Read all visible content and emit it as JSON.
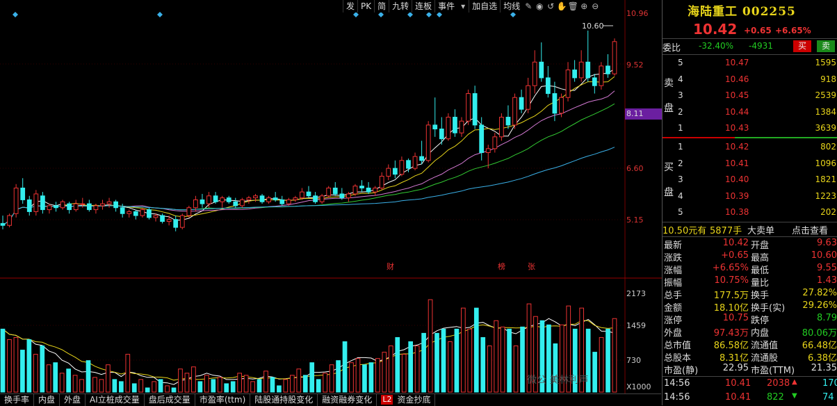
{
  "toolbar": {
    "items": [
      "发",
      "PK",
      "简",
      "九转",
      "连板",
      "事件"
    ],
    "more_items": [
      "加自选",
      "均线"
    ],
    "icons": [
      "dropdown-icon",
      "pen-icon",
      "eye-icon",
      "undo-icon",
      "hand-icon",
      "delete-icon",
      "zoom-in-icon",
      "zoom-out-icon"
    ]
  },
  "colors": {
    "up": "#e33",
    "down": "#3ee",
    "ma5": "#ffffff",
    "ma10": "#e8d51a",
    "ma20": "#d47ad4",
    "ma30": "#3c3",
    "ma60": "#3ab0e8"
  },
  "chart_data": {
    "type": "candlestick",
    "price_axis_ticks": [
      "10.96",
      "9.52",
      "8.11",
      "6.60",
      "5.15"
    ],
    "current_price_tag": "8.11",
    "high_marker": "10.60",
    "event_markers": [
      "财",
      "榜",
      "张"
    ],
    "volume_axis_ticks": [
      "2173",
      "1459",
      "730",
      "X1000"
    ],
    "ylim": [
      4.5,
      11.3
    ],
    "candles": [
      [
        5.8,
        6.0,
        5.65,
        5.75
      ],
      [
        5.75,
        6.05,
        5.7,
        6.0
      ],
      [
        6.05,
        6.8,
        5.95,
        6.7
      ],
      [
        6.7,
        6.95,
        6.3,
        6.4
      ],
      [
        6.4,
        6.5,
        6.0,
        6.1
      ],
      [
        6.1,
        6.65,
        6.0,
        6.55
      ],
      [
        6.5,
        6.6,
        6.05,
        6.15
      ],
      [
        6.15,
        6.3,
        6.05,
        6.25
      ],
      [
        6.25,
        6.35,
        6.1,
        6.2
      ],
      [
        6.2,
        6.4,
        6.15,
        6.35
      ],
      [
        6.3,
        6.35,
        6.05,
        6.15
      ],
      [
        6.15,
        6.4,
        6.1,
        6.3
      ],
      [
        6.3,
        6.45,
        6.2,
        6.3
      ],
      [
        6.3,
        6.4,
        6.1,
        6.15
      ],
      [
        6.15,
        6.3,
        6.05,
        6.25
      ],
      [
        6.25,
        6.4,
        6.15,
        6.3
      ],
      [
        6.3,
        6.45,
        6.2,
        6.35
      ],
      [
        6.35,
        6.4,
        6.1,
        6.2
      ],
      [
        6.2,
        6.3,
        5.95,
        6.05
      ],
      [
        6.05,
        6.15,
        5.95,
        6.1
      ],
      [
        6.1,
        6.15,
        5.9,
        6.0
      ],
      [
        6.0,
        6.2,
        5.95,
        6.15
      ],
      [
        6.15,
        6.2,
        5.9,
        5.95
      ],
      [
        5.95,
        6.05,
        5.85,
        6.0
      ],
      [
        6.0,
        6.05,
        5.8,
        5.85
      ],
      [
        5.85,
        6.0,
        5.75,
        5.9
      ],
      [
        5.9,
        6.0,
        5.6,
        5.7
      ],
      [
        5.7,
        6.05,
        5.65,
        6.0
      ],
      [
        6.0,
        6.25,
        5.95,
        6.2
      ],
      [
        6.2,
        6.5,
        6.1,
        6.4
      ],
      [
        6.4,
        6.55,
        6.2,
        6.3
      ],
      [
        6.3,
        6.6,
        6.2,
        6.5
      ],
      [
        6.5,
        6.6,
        6.3,
        6.35
      ],
      [
        6.35,
        6.5,
        6.2,
        6.45
      ],
      [
        6.45,
        6.5,
        6.3,
        6.35
      ],
      [
        6.35,
        6.45,
        6.2,
        6.25
      ],
      [
        6.25,
        6.45,
        6.2,
        6.4
      ],
      [
        6.4,
        6.5,
        6.3,
        6.45
      ],
      [
        6.45,
        6.55,
        6.35,
        6.5
      ],
      [
        6.5,
        6.55,
        6.3,
        6.35
      ],
      [
        6.35,
        6.5,
        6.3,
        6.45
      ],
      [
        6.45,
        6.6,
        6.35,
        6.4
      ],
      [
        6.4,
        6.5,
        6.25,
        6.3
      ],
      [
        6.3,
        6.45,
        6.25,
        6.4
      ],
      [
        6.4,
        6.5,
        6.35,
        6.45
      ],
      [
        6.45,
        6.7,
        6.4,
        6.6
      ],
      [
        6.6,
        6.75,
        6.45,
        6.5
      ],
      [
        6.5,
        6.6,
        6.3,
        6.35
      ],
      [
        6.35,
        6.55,
        6.3,
        6.5
      ],
      [
        6.5,
        6.75,
        6.45,
        6.7
      ],
      [
        6.7,
        6.85,
        6.5,
        6.55
      ],
      [
        6.55,
        6.7,
        6.4,
        6.45
      ],
      [
        6.45,
        6.6,
        6.35,
        6.55
      ],
      [
        6.55,
        6.8,
        6.5,
        6.75
      ],
      [
        6.75,
        6.9,
        6.6,
        6.7
      ],
      [
        6.7,
        6.85,
        6.55,
        6.6
      ],
      [
        6.6,
        6.75,
        6.5,
        6.7
      ],
      [
        6.7,
        7.1,
        6.65,
        7.0
      ],
      [
        7.0,
        7.3,
        6.9,
        7.2
      ],
      [
        7.2,
        7.4,
        6.95,
        7.05
      ],
      [
        7.05,
        7.5,
        7.0,
        7.4
      ],
      [
        7.4,
        7.45,
        7.1,
        7.2
      ],
      [
        7.2,
        7.6,
        7.15,
        7.5
      ],
      [
        7.5,
        7.9,
        7.3,
        7.4
      ],
      [
        7.4,
        8.4,
        7.35,
        8.3
      ],
      [
        8.3,
        9.0,
        8.0,
        8.2
      ],
      [
        8.2,
        8.5,
        7.8,
        7.95
      ],
      [
        7.95,
        8.6,
        7.9,
        8.5
      ],
      [
        8.5,
        8.7,
        8.0,
        8.1
      ],
      [
        8.1,
        8.5,
        8.0,
        8.4
      ],
      [
        8.4,
        9.2,
        8.3,
        9.1
      ],
      [
        9.1,
        9.3,
        8.2,
        8.3
      ],
      [
        8.3,
        8.5,
        7.4,
        7.6
      ],
      [
        7.6,
        7.8,
        7.2,
        7.7
      ],
      [
        7.7,
        8.1,
        7.6,
        8.0
      ],
      [
        8.0,
        8.6,
        7.9,
        8.5
      ],
      [
        8.5,
        8.8,
        8.2,
        8.3
      ],
      [
        8.3,
        9.1,
        8.2,
        9.0
      ],
      [
        9.0,
        9.2,
        8.6,
        8.7
      ],
      [
        8.7,
        9.5,
        8.6,
        9.3
      ],
      [
        9.3,
        10.2,
        9.1,
        9.9
      ],
      [
        9.9,
        10.4,
        9.4,
        9.5
      ],
      [
        9.5,
        9.8,
        9.0,
        9.1
      ],
      [
        9.1,
        9.4,
        8.4,
        8.6
      ],
      [
        8.6,
        9.1,
        8.5,
        9.0
      ],
      [
        9.0,
        9.9,
        8.9,
        9.7
      ],
      [
        9.7,
        9.95,
        9.4,
        9.5
      ],
      [
        9.5,
        10.2,
        9.4,
        9.9
      ],
      [
        9.9,
        10.7,
        9.4,
        9.5
      ],
      [
        9.5,
        9.6,
        9.1,
        9.3
      ],
      [
        9.3,
        9.9,
        9.2,
        9.8
      ],
      [
        9.8,
        10.1,
        9.5,
        9.6
      ],
      [
        9.6,
        10.5,
        9.55,
        10.42
      ]
    ],
    "volumes": [
      1500,
      1250,
      1300,
      1000,
      1250,
      900,
      1100,
      650,
      700,
      450,
      550,
      400,
      300,
      750,
      350,
      300,
      650,
      300,
      250,
      900,
      200,
      300,
      100,
      250,
      300,
      150,
      100,
      550,
      450,
      600,
      250,
      400,
      300,
      350,
      200,
      250,
      450,
      400,
      250,
      300,
      500,
      350,
      150,
      300,
      400,
      550,
      400,
      700,
      300,
      450,
      650,
      750,
      1200,
      700,
      800,
      650,
      700,
      800,
      950,
      1100,
      1300,
      900,
      1200,
      1100,
      1400,
      2200,
      1400,
      1500,
      1200,
      1500,
      2000,
      1500,
      2000,
      1300,
      1100,
      1700,
      1550,
      1500,
      1100,
      1550,
      2100,
      1800,
      1700,
      1600,
      1150,
      1600,
      2050,
      1500,
      2000,
      1500,
      950,
      1300,
      1500,
      1750
    ]
  },
  "panel": {
    "title": "海陆重工 002255",
    "price": "10.42",
    "change": "+0.65",
    "change_pct": "+6.65%",
    "weibi_label": "委比",
    "weibi_val": "-32.40%",
    "weicha_val": "-4931",
    "buy_btn": "买",
    "sell_btn": "卖",
    "sell_side": [
      "卖",
      "盘"
    ],
    "buy_side": [
      "买",
      "盘"
    ],
    "asks": [
      {
        "lvl": "5",
        "price": "10.47",
        "vol": "1595"
      },
      {
        "lvl": "4",
        "price": "10.46",
        "vol": "918"
      },
      {
        "lvl": "3",
        "price": "10.45",
        "vol": "2539"
      },
      {
        "lvl": "2",
        "price": "10.44",
        "vol": "1384"
      },
      {
        "lvl": "1",
        "price": "10.43",
        "vol": "3639"
      }
    ],
    "bids": [
      {
        "lvl": "1",
        "price": "10.42",
        "vol": "802"
      },
      {
        "lvl": "2",
        "price": "10.41",
        "vol": "1096"
      },
      {
        "lvl": "3",
        "price": "10.40",
        "vol": "1821"
      },
      {
        "lvl": "4",
        "price": "10.39",
        "vol": "1223"
      },
      {
        "lvl": "5",
        "price": "10.38",
        "vol": "202"
      }
    ],
    "bigorder": {
      "price": "10.50元有",
      "qty": "5877手",
      "label": "大卖单",
      "link": "点击查看"
    },
    "stats": [
      {
        "k1": "最新",
        "v1": "10.42",
        "c1": "red",
        "k2": "开盘",
        "v2": "9.63",
        "c2": "red"
      },
      {
        "k1": "涨跌",
        "v1": "+0.65",
        "c1": "red",
        "k2": "最高",
        "v2": "10.60",
        "c2": "red"
      },
      {
        "k1": "涨幅",
        "v1": "+6.65%",
        "c1": "red",
        "k2": "最低",
        "v2": "9.55",
        "c2": "red"
      },
      {
        "k1": "振幅",
        "v1": "10.75%",
        "c1": "red",
        "k2": "量比",
        "v2": "1.43",
        "c2": "red"
      },
      {
        "k1": "总手",
        "v1": "177.5万",
        "c1": "yel",
        "k2": "换手",
        "v2": "27.82%",
        "c2": "yel"
      },
      {
        "k1": "金额",
        "v1": "18.10亿",
        "c1": "yel",
        "k2": "换手(实)",
        "v2": "29.26%",
        "c2": "yel"
      },
      {
        "k1": "涨停",
        "v1": "10.75",
        "c1": "red",
        "k2": "跌停",
        "v2": "8.79",
        "c2": "grn"
      },
      {
        "k1": "外盘",
        "v1": "97.43万",
        "c1": "red",
        "k2": "内盘",
        "v2": "80.06万",
        "c2": "grn"
      },
      {
        "k1": "总市值",
        "v1": "86.58亿",
        "c1": "yel",
        "k2": "流通值",
        "v2": "66.48亿",
        "c2": "yel"
      },
      {
        "k1": "总股本",
        "v1": "8.31亿",
        "c1": "yel",
        "k2": "流通股",
        "v2": "6.38亿",
        "c2": "yel"
      },
      {
        "k1": "市盈(静)",
        "v1": "22.95",
        "c1": "white",
        "k2": "市盈(TTM)",
        "v2": "21.35",
        "c2": "white"
      }
    ],
    "ticks": [
      {
        "time": "14:56",
        "price": "10.41",
        "vol": "2038",
        "dir": "up",
        "n": "170"
      },
      {
        "time": "14:56",
        "price": "10.41",
        "vol": "822",
        "dir": "down",
        "n": "74"
      }
    ]
  },
  "tabs": [
    "换手率",
    "内盘",
    "外盘",
    "AI立桩成交量",
    "盘后成交量",
    "市盈率(ttm)",
    "陆股通持股变化",
    "融资融券变化",
    "L2",
    "资金抄底"
  ],
  "watermark": "微公    美林利声"
}
